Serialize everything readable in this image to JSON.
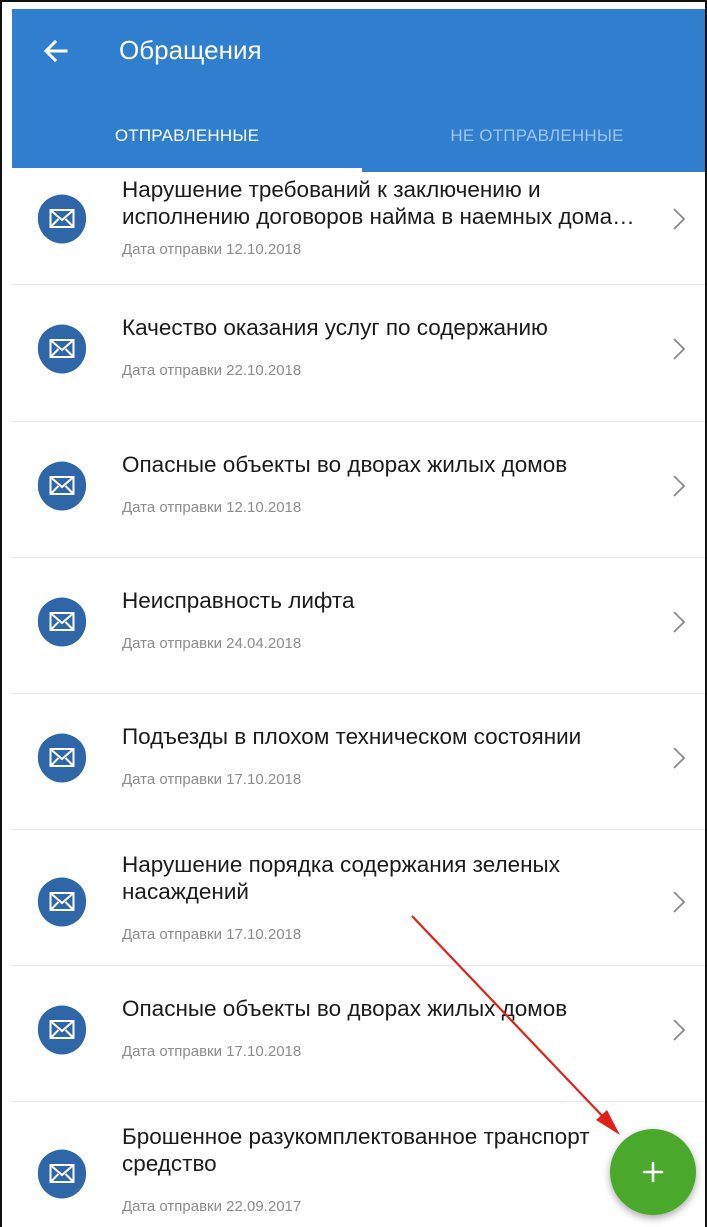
{
  "header": {
    "title": "Обращения",
    "back_icon": "arrow-left-icon"
  },
  "tabs": [
    {
      "label": "ОТПРАВЛЕННЫЕ",
      "selected": true
    },
    {
      "label": "НЕ ОТПРАВЛЕННЫЕ",
      "selected": false
    }
  ],
  "items": [
    {
      "title_lines": [
        "Нарушение требований к заключению и",
        "исполнению договоров найма в наемных дома…"
      ],
      "date": "Дата отправки 12.10.2018"
    },
    {
      "title_lines": [
        "Качество оказания услуг по содержанию"
      ],
      "date": "Дата отправки 22.10.2018"
    },
    {
      "title_lines": [
        "Опасные объекты во дворах жилых домов"
      ],
      "date": "Дата отправки 12.10.2018"
    },
    {
      "title_lines": [
        "Неисправность лифта"
      ],
      "date": "Дата отправки 24.04.2018"
    },
    {
      "title_lines": [
        "Подъезды в плохом техническом состоянии"
      ],
      "date": "Дата отправки 17.10.2018"
    },
    {
      "title_lines": [
        "Нарушение порядка содержания зеленых",
        "насаждений"
      ],
      "date": "Дата отправки 17.10.2018"
    },
    {
      "title_lines": [
        "Опасные объекты во дворах жилых домов"
      ],
      "date": "Дата отправки 17.10.2018"
    },
    {
      "title_lines": [
        "Брошенное разукомплектованное транспорт",
        "средство"
      ],
      "date": "Дата отправки 22.09.2017"
    }
  ],
  "fab": {
    "icon": "plus-icon",
    "label": "+"
  },
  "colors": {
    "appbar": "#2f7fce",
    "avatar": "#2f66a8",
    "fab": "#4aa82b",
    "annotation_arrow": "#e0201a"
  }
}
